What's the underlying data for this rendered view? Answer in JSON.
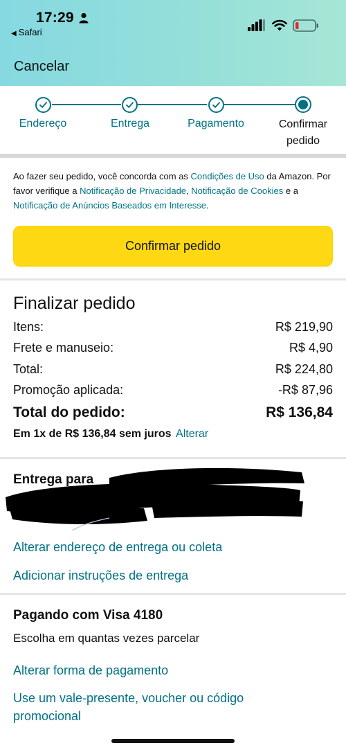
{
  "status_bar": {
    "time": "17:29",
    "back_app": "Safari",
    "icons": [
      "person-icon",
      "signal-icon",
      "wifi-icon",
      "battery-icon"
    ]
  },
  "header": {
    "cancel_label": "Cancelar"
  },
  "stepper": {
    "steps": [
      {
        "label": "Endereço",
        "state": "done"
      },
      {
        "label": "Entrega",
        "state": "done"
      },
      {
        "label": "Pagamento",
        "state": "done"
      },
      {
        "label_line1": "Confirmar",
        "label_line2": "pedido",
        "state": "current"
      }
    ]
  },
  "legal": {
    "t1": "Ao fazer seu pedido, você concorda com as ",
    "l1": "Condições de Uso",
    "t2": " da Amazon. Por favor verifique a ",
    "l2": "Notificação de Privacidade",
    "t3": ", ",
    "l3": "Notificação de Cookies",
    "t4": " e a ",
    "l4": "Notificação de Anúncios Baseados em Interesse",
    "t5": "."
  },
  "confirm_button": {
    "label": "Confirmar pedido"
  },
  "summary": {
    "title": "Finalizar pedido",
    "rows": [
      {
        "label": "Itens:",
        "value": "R$ 219,90"
      },
      {
        "label": "Frete e manuseio:",
        "value": "R$ 4,90"
      },
      {
        "label": "Total:",
        "value": "R$ 224,80"
      },
      {
        "label": "Promoção aplicada:",
        "value": "-R$ 87,96"
      }
    ],
    "order_total": {
      "label": "Total do pedido:",
      "value": "R$ 136,84"
    },
    "installment": {
      "text": "Em 1x de R$ 136,84 sem juros",
      "link": "Alterar"
    }
  },
  "delivery": {
    "title": "Entrega para",
    "change_address": "Alterar endereço de entrega ou coleta",
    "add_instructions": "Adicionar instruções de entrega"
  },
  "payment": {
    "title": "Pagando com Visa 4180",
    "subtitle": "Escolha em quantas vezes parcelar",
    "change_payment": "Alterar forma de pagamento",
    "gift_line1": "Use um vale-presente, voucher ou código",
    "gift_line2": "promocional"
  },
  "colors": {
    "accent": "#007185",
    "button": "#ffd814",
    "header_start": "#86d9e1",
    "header_end": "#a6e6d6"
  }
}
